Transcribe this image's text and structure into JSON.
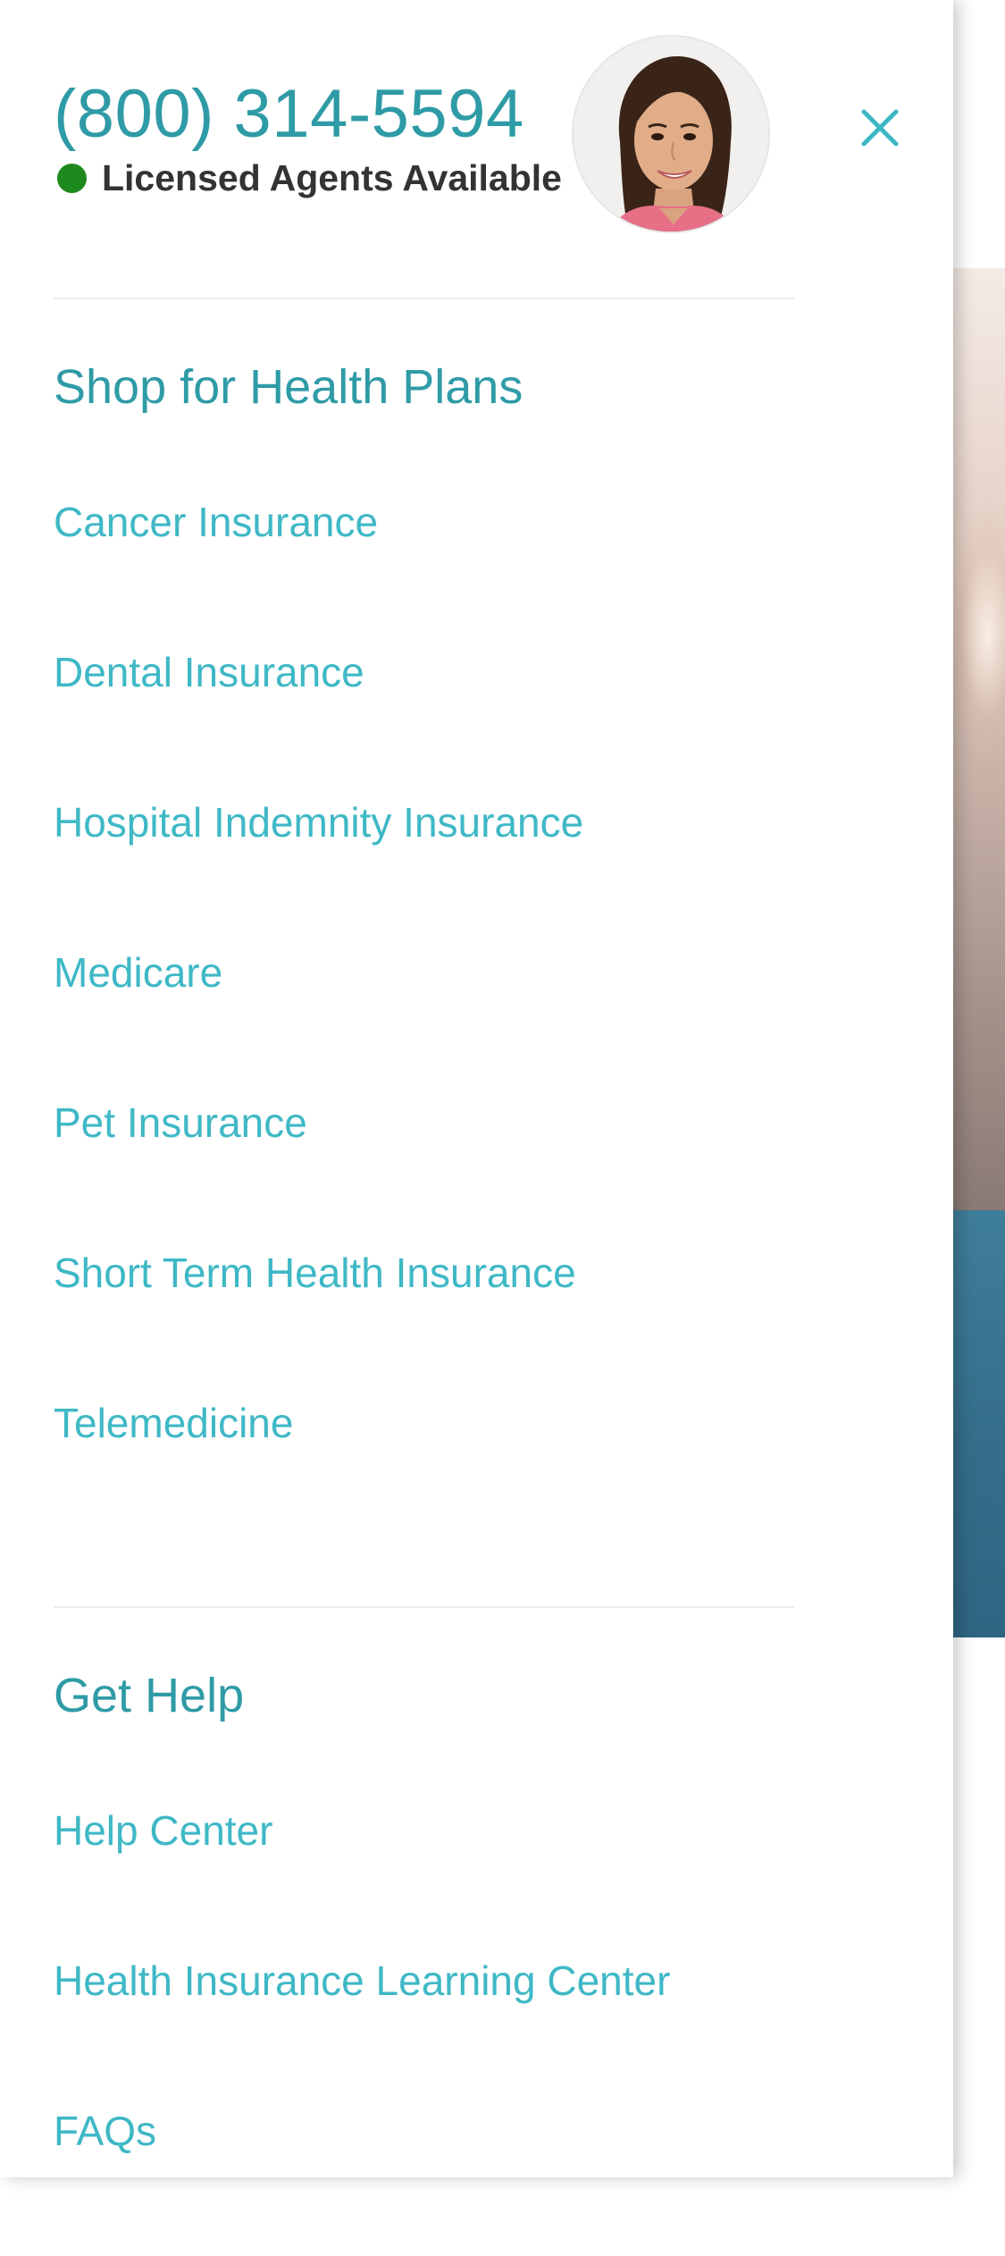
{
  "contact": {
    "phone": "(800) 314-5594",
    "availability_text": "Licensed Agents Available",
    "status_color": "#1e8a1e"
  },
  "header": {
    "avatar_icon": "agent-photo",
    "close_icon": "close-x-icon"
  },
  "menu": {
    "shop": {
      "title": "Shop for Health Plans",
      "items": [
        {
          "label": "Cancer Insurance"
        },
        {
          "label": "Dental Insurance"
        },
        {
          "label": "Hospital Indemnity Insurance"
        },
        {
          "label": "Medicare"
        },
        {
          "label": "Pet Insurance"
        },
        {
          "label": "Short Term Health Insurance"
        },
        {
          "label": "Telemedicine"
        }
      ]
    },
    "help": {
      "title": "Get Help",
      "items": [
        {
          "label": "Help Center"
        },
        {
          "label": "Health Insurance Learning Center"
        },
        {
          "label": "FAQs"
        }
      ]
    }
  },
  "colors": {
    "primary_teal": "#2e9ba6",
    "link_teal": "#3fb8c6",
    "text_dark": "#333333",
    "divider": "#ececec"
  }
}
